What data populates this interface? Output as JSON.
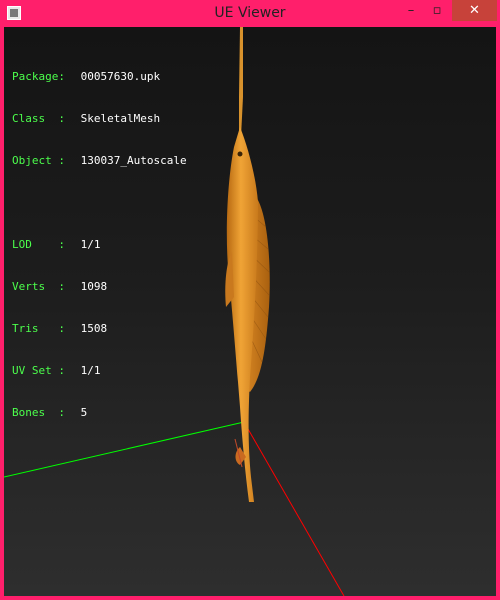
{
  "window": {
    "title": "UE Viewer",
    "buttons": {
      "minimize": "–",
      "maximize": "▫",
      "close": "✕"
    }
  },
  "info": {
    "package": {
      "label": "Package:",
      "value": "00057630.upk"
    },
    "class": {
      "label": "Class  :",
      "value": "SkeletalMesh"
    },
    "object": {
      "label": "Object :",
      "value": "130037_Autoscale"
    },
    "lod": {
      "label": "LOD    :",
      "value": "1/1"
    },
    "verts": {
      "label": "Verts  :",
      "value": "1098"
    },
    "tris": {
      "label": "Tris   :",
      "value": "1508"
    },
    "uvset": {
      "label": "UV Set :",
      "value": "1/1"
    },
    "bones": {
      "label": "Bones  :",
      "value": "5"
    }
  },
  "colors": {
    "frame": "#ff1f6b",
    "label_text": "#4cff4c",
    "value_text": "#ffffff",
    "axis_x": "#ff0000",
    "axis_y": "#00ff00",
    "mesh": "#e89a2a"
  }
}
